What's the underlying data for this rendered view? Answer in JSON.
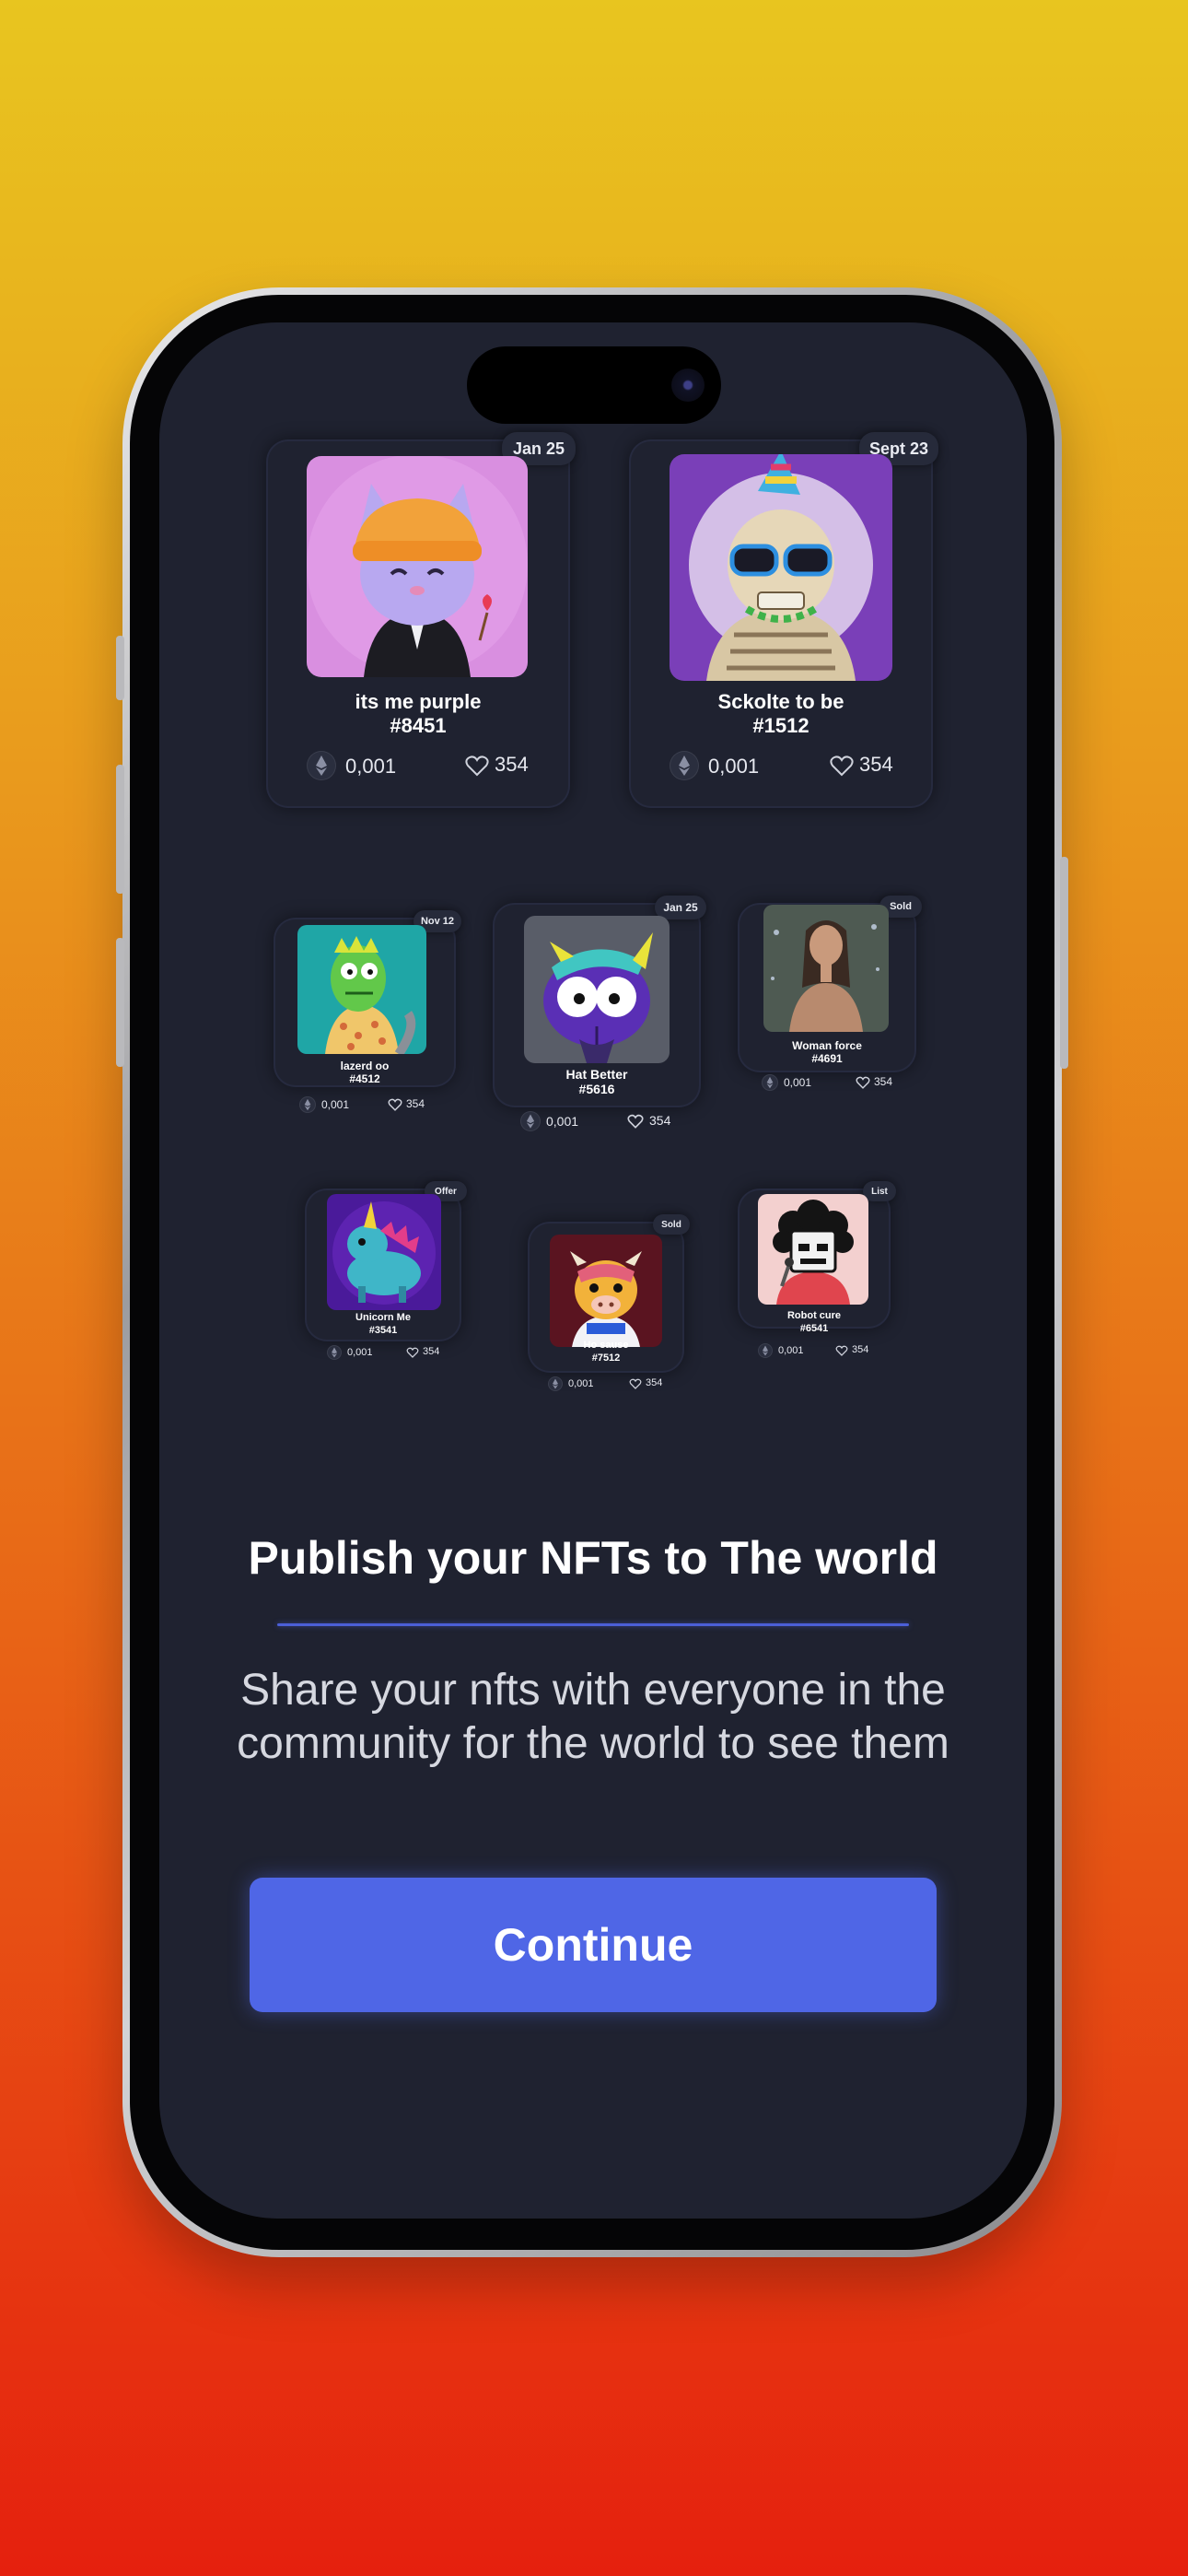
{
  "nfts": [
    {
      "name": "its me purple",
      "number": "#8451",
      "badge": "Jan 25",
      "price": "0,001",
      "likes": "354",
      "art": "purple-cat"
    },
    {
      "name": "Sckolte to be",
      "number": "#1512",
      "badge": "Sept 23",
      "price": "0,001",
      "likes": "354",
      "art": "party-skeleton"
    },
    {
      "name": "lazerd oo",
      "number": "#4512",
      "badge": "Nov 12",
      "price": "0,001",
      "likes": "354",
      "art": "green-lizard"
    },
    {
      "name": "Hat Better",
      "number": "#5616",
      "badge": "Jan 25",
      "price": "0,001",
      "likes": "354",
      "art": "purple-hat-creature"
    },
    {
      "name": "Woman force",
      "number": "#4691",
      "badge": "Sold",
      "price": "0,001",
      "likes": "354",
      "art": "woman-figure"
    },
    {
      "name": "Unicorn Me",
      "number": "#3541",
      "badge": "Offer",
      "price": "0,001",
      "likes": "354",
      "art": "blue-unicorn"
    },
    {
      "name": "Ho sause",
      "number": "#7512",
      "badge": "Sold",
      "price": "0,001",
      "likes": "354",
      "art": "cow-character"
    },
    {
      "name": "Robot cure",
      "number": "#6541",
      "badge": "List",
      "price": "0,001",
      "likes": "354",
      "art": "robot-afro"
    }
  ],
  "onboarding": {
    "title": "Publish your NFTs to The world",
    "subtitle": "Share your nfts with everyone in the community for the world to see them",
    "cta_label": "Continue"
  },
  "colors": {
    "background_top": "#e8c51f",
    "background_bottom": "#e5200e",
    "screen": "#1f2230",
    "accent": "#4f66e6"
  }
}
